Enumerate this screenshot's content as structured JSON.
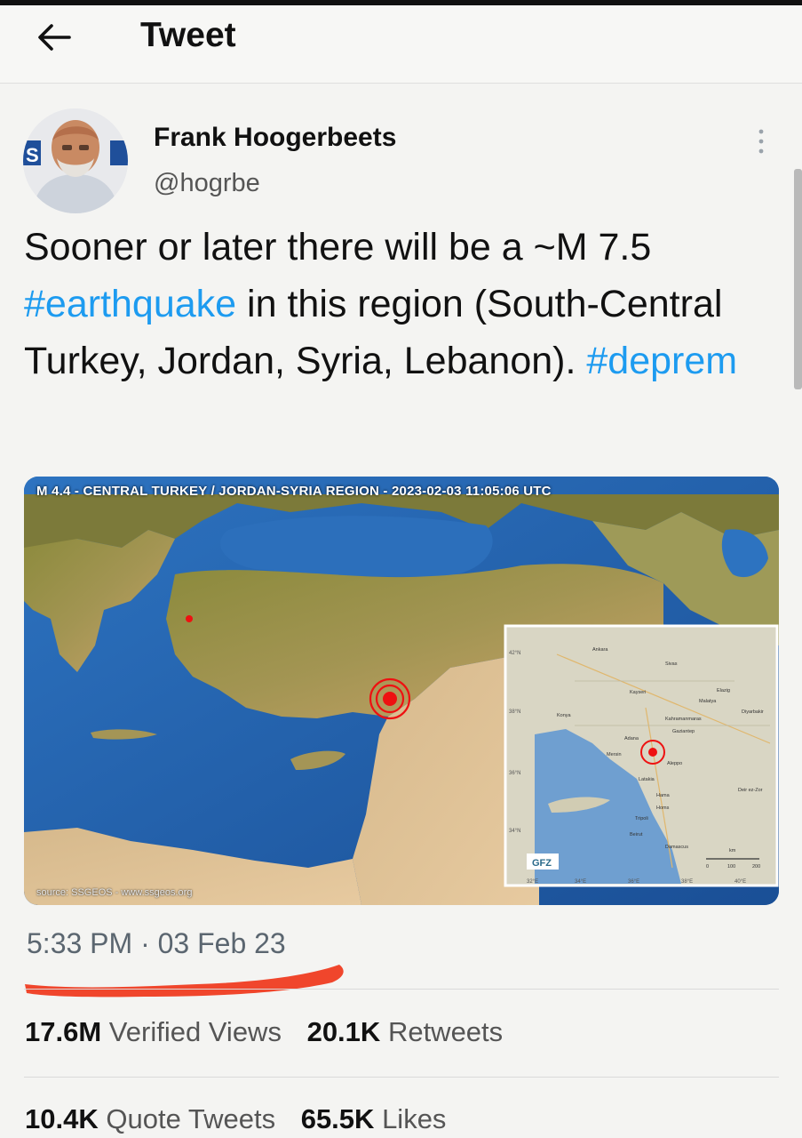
{
  "header": {
    "title": "Tweet",
    "back_icon": "arrow-left-icon"
  },
  "author": {
    "name": "Frank Hoogerbeets",
    "handle": "@hogrbe",
    "avatar_icon": "avatar",
    "more_icon": "more-vertical-icon"
  },
  "tweet": {
    "text_before": "Sooner or later there will be a ~M 7.5 ",
    "hashtag_1": "#earthquake",
    "text_middle": " in this region (South-Central Turkey, Jordan, Syria, Lebanon). ",
    "hashtag_2": "#deprem"
  },
  "media": {
    "caption": "M 4.4 - CENTRAL TURKEY / JORDAN-SYRIA REGION - 2023-02-03 11:05:06 UTC",
    "source": "source: SSGEOS - www.ssgeos.org",
    "inset_logo": "GFZ",
    "inset_lat_labels": [
      "42°N",
      "38°N",
      "36°N",
      "34°N"
    ],
    "inset_lon_labels": [
      "32°E",
      "34°E",
      "36°E",
      "38°E",
      "40°E"
    ],
    "inset_places": [
      "Ankara",
      "Sivas",
      "Kayseri",
      "Malatya",
      "Elazig",
      "Konya",
      "Kahramanmaras",
      "Gaziantep",
      "Adana",
      "Mersin",
      "Aleppo",
      "Diyarbakir",
      "Latakia",
      "Hama",
      "Homs",
      "Tripoli",
      "Beirut",
      "Damascus",
      "Deir ez-Zor"
    ],
    "inset_scale": [
      "km",
      "0",
      "100",
      "200"
    ]
  },
  "meta": {
    "timestamp": "5:33 PM · 03 Feb 23"
  },
  "stats": {
    "views_count": "17.6M",
    "views_label": "Verified Views",
    "retweets_count": "20.1K",
    "retweets_label": "Retweets",
    "quotes_count": "10.4K",
    "quotes_label": "Quote Tweets",
    "likes_count": "65.5K",
    "likes_label": "Likes"
  },
  "colors": {
    "accent_hashtag": "#1d9bf0",
    "annotation_underline": "#f0462c"
  }
}
